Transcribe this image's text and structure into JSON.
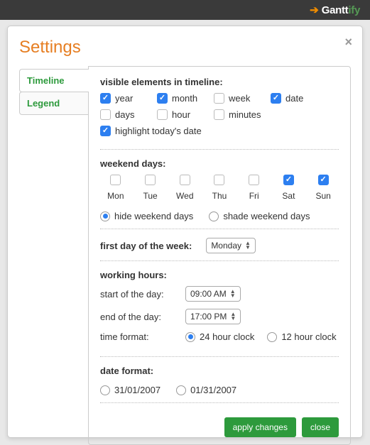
{
  "brand": {
    "name_a": "Gantt",
    "name_b": "ify"
  },
  "modal": {
    "title": "Settings"
  },
  "tabs": {
    "timeline": "Timeline",
    "legend": "Legend"
  },
  "visible": {
    "title": "visible elements in timeline:",
    "year": "year",
    "month": "month",
    "week": "week",
    "date": "date",
    "days": "days",
    "hour": "hour",
    "minutes": "minutes",
    "highlight": "highlight today's date",
    "checked": {
      "year": true,
      "month": true,
      "week": false,
      "date": true,
      "days": false,
      "hour": false,
      "minutes": false,
      "highlight": true
    }
  },
  "weekend": {
    "title": "weekend days:",
    "days": [
      "Mon",
      "Tue",
      "Wed",
      "Thu",
      "Fri",
      "Sat",
      "Sun"
    ],
    "checked": [
      false,
      false,
      false,
      false,
      false,
      true,
      true
    ],
    "hide": "hide weekend days",
    "shade": "shade weekend days",
    "mode": "hide"
  },
  "firstday": {
    "label": "first day of the week:",
    "value": "Monday"
  },
  "hours": {
    "title": "working hours:",
    "start_label": "start of the day:",
    "end_label": "end of the day:",
    "start": "09:00 AM",
    "end": "17:00 PM",
    "format_label": "time format:",
    "fmt24": "24 hour clock",
    "fmt12": "12 hour clock",
    "format": "24"
  },
  "datefmt": {
    "title": "date format:",
    "dmy": "31/01/2007",
    "mdy": "01/31/2007",
    "value": ""
  },
  "buttons": {
    "apply": "apply changes",
    "close": "close"
  }
}
